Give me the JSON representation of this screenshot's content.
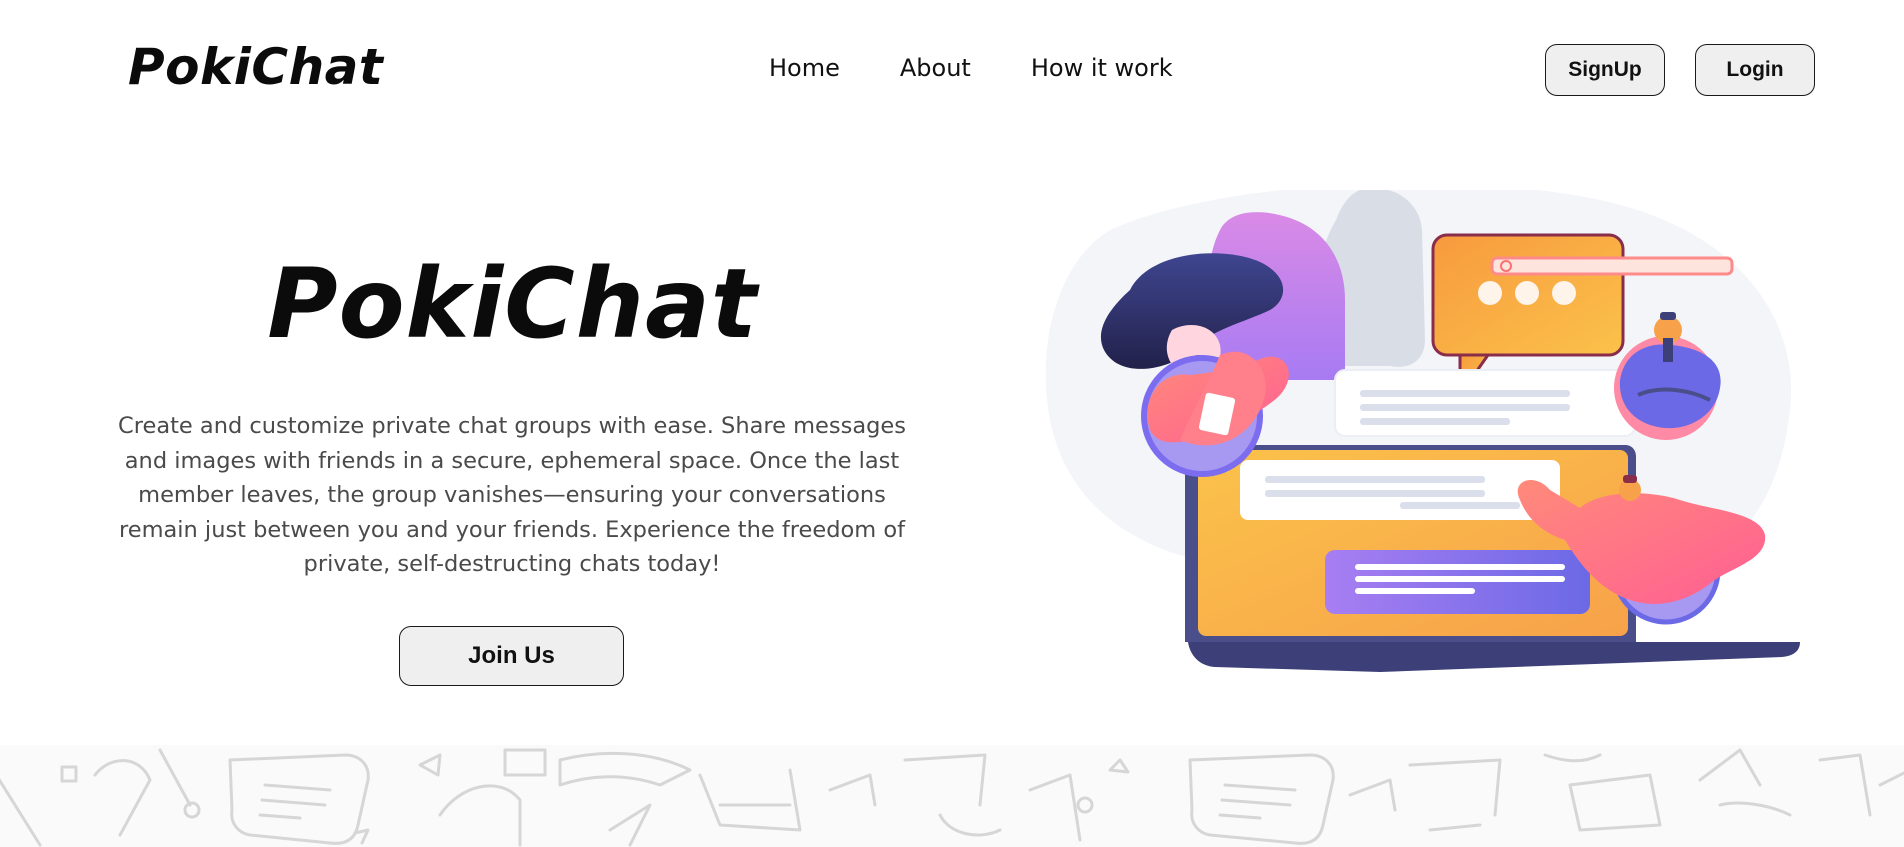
{
  "brand": {
    "logo_text": "PokiChat"
  },
  "nav": {
    "links": [
      {
        "label": "Home"
      },
      {
        "label": "About"
      },
      {
        "label": "How it work"
      }
    ],
    "signup_label": "SignUp",
    "login_label": "Login"
  },
  "hero": {
    "title": "PokiChat",
    "description": "Create and customize private chat groups with ease. Share messages and images with friends in a secure, ephemeral space. Once the last member leaves, the group vanishes—ensuring your conversations remain just between you and your friends. Experience the freedom of private, self-destructing chats today!",
    "join_label": "Join Us"
  },
  "illustration": {
    "icon": "chat-laptop-illustration",
    "colors": {
      "purple": "#7b6cf0",
      "orange": "#fbb040",
      "pink": "#ff6f91",
      "navy": "#3c3f78"
    }
  },
  "pattern": {
    "icon": "chat-doodle-pattern"
  }
}
